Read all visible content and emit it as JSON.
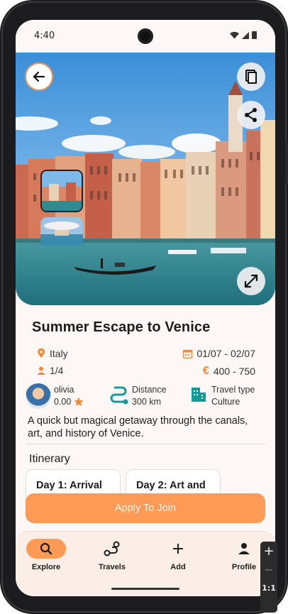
{
  "status_bar": {
    "time": "4:40"
  },
  "hero": {
    "back_icon": "arrow-left-icon",
    "copy_icon": "copy-icon",
    "share_icon": "share-icon",
    "expand_icon": "expand-icon"
  },
  "trip": {
    "title": "Summer Escape to Venice",
    "country": "Italy",
    "participants": "1/4",
    "dates": "01/07 - 02/07",
    "price": "400 - 750",
    "owner_name": "olivia",
    "owner_rating": "0.00",
    "distance_label": "Distance",
    "distance_value": "300 km",
    "travel_type_label": "Travel type",
    "travel_type_value": "Culture",
    "description": "A quick but magical getaway through the canals, art, and history of Venice."
  },
  "itinerary": {
    "title": "Itinerary",
    "days": [
      {
        "label": "Day 1: Arrival"
      },
      {
        "label": "Day 2: Art and"
      }
    ]
  },
  "apply_button": "Apply To Join",
  "nav": {
    "items": [
      {
        "label": "Explore",
        "icon": "search-icon",
        "active": true
      },
      {
        "label": "Travels",
        "icon": "route-icon",
        "active": false
      },
      {
        "label": "Add",
        "icon": "plus-icon",
        "active": false
      },
      {
        "label": "Profile",
        "icon": "person-icon",
        "active": false
      }
    ]
  },
  "zoom": {
    "plus": "+",
    "minus": "−",
    "ratio": "1:1"
  },
  "colors": {
    "accent": "#fd9a56",
    "background": "#fdf8f6",
    "nav_background": "#fbeee6",
    "teal": "#119b9b",
    "orange_icon": "#f28a3c"
  }
}
